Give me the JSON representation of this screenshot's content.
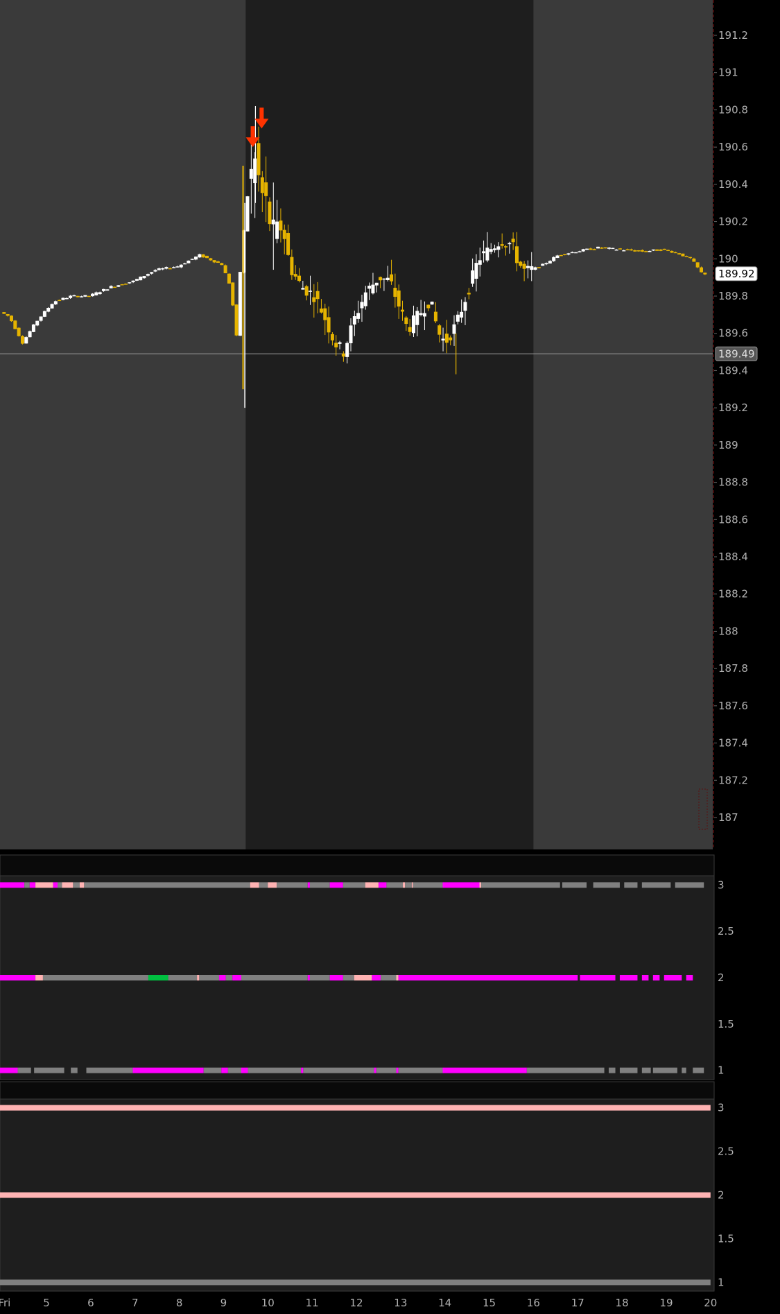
{
  "chart_data": {
    "type": "candlestick",
    "price_panel": {
      "y_ticks": [
        "191.2",
        "191",
        "190.8",
        "190.6",
        "190.4",
        "190.2",
        "190",
        "189.8",
        "189.6",
        "189.4",
        "189.2",
        "189",
        "188.8",
        "188.6",
        "188.4",
        "188.2",
        "188",
        "187.8",
        "187.6",
        "187.4",
        "187.2",
        "187"
      ],
      "y_range": [
        186.9,
        191.3
      ],
      "last_price_label": "189.92",
      "last_price": 189.92,
      "horizontal_line_label": "189.49",
      "horizontal_line": 189.49,
      "regular_session_hours": [
        9.5,
        16.0
      ],
      "signal_arrows": [
        {
          "hour": 9.66,
          "price": 190.6,
          "direction": "down"
        },
        {
          "hour": 9.86,
          "price": 190.7,
          "direction": "down"
        }
      ],
      "colors": {
        "up": "#ffffff",
        "down": "#e6b400",
        "arrow": "#ff3300",
        "session_bg": "#1e1e1e",
        "extended_bg": "#3a3a3a",
        "hline": "#a0a0a0"
      },
      "control_points": [
        [
          3.95,
          189.72
        ],
        [
          4.2,
          189.69
        ],
        [
          4.5,
          189.55
        ],
        [
          4.8,
          189.66
        ],
        [
          5.2,
          189.77
        ],
        [
          5.6,
          189.8
        ],
        [
          6,
          189.8
        ],
        [
          6.5,
          189.85
        ],
        [
          7,
          189.88
        ],
        [
          7.5,
          189.94
        ],
        [
          8,
          189.96
        ],
        [
          8.5,
          190.02
        ],
        [
          9,
          189.97
        ],
        [
          9.2,
          189.85
        ],
        [
          9.35,
          189.55
        ],
        [
          9.42,
          189.95
        ],
        [
          9.5,
          190.15
        ],
        [
          9.62,
          190.42
        ],
        [
          9.75,
          190.52
        ],
        [
          9.9,
          190.35
        ],
        [
          10.05,
          190.25
        ],
        [
          10.2,
          190.08
        ],
        [
          10.35,
          190.2
        ],
        [
          10.55,
          189.95
        ],
        [
          10.8,
          189.85
        ],
        [
          11.1,
          189.8
        ],
        [
          11.3,
          189.7
        ],
        [
          11.55,
          189.55
        ],
        [
          11.75,
          189.5
        ],
        [
          12,
          189.68
        ],
        [
          12.25,
          189.82
        ],
        [
          12.55,
          189.9
        ],
        [
          12.8,
          189.88
        ],
        [
          13,
          189.75
        ],
        [
          13.2,
          189.62
        ],
        [
          13.45,
          189.7
        ],
        [
          13.7,
          189.78
        ],
        [
          13.9,
          189.6
        ],
        [
          14.05,
          189.55
        ],
        [
          14.3,
          189.65
        ],
        [
          14.55,
          189.82
        ],
        [
          14.8,
          190.0
        ],
        [
          15.05,
          190.05
        ],
        [
          15.3,
          190.1
        ],
        [
          15.55,
          190.08
        ],
        [
          15.7,
          189.98
        ],
        [
          15.85,
          189.93
        ],
        [
          16.2,
          189.96
        ],
        [
          16.6,
          190.02
        ],
        [
          17,
          190.04
        ],
        [
          17.5,
          190.06
        ],
        [
          18,
          190.05
        ],
        [
          18.5,
          190.04
        ],
        [
          19,
          190.05
        ],
        [
          19.3,
          190.03
        ],
        [
          19.6,
          190.0
        ],
        [
          19.85,
          189.92
        ]
      ]
    },
    "indicator_panel_1": {
      "y_ticks": [
        "3",
        "2.5",
        "2",
        "1.5",
        "1"
      ],
      "y_range": [
        0.9,
        3.1
      ],
      "rows": [
        {
          "level": 3,
          "segments": [
            [
              3.95,
              4.5,
              "#ff00ff"
            ],
            [
              4.5,
              4.62,
              "#808080"
            ],
            [
              4.62,
              4.75,
              "#ff00ff"
            ],
            [
              4.75,
              5.15,
              "#ffb3b3"
            ],
            [
              5.15,
              5.25,
              "#ff00ff"
            ],
            [
              5.25,
              5.35,
              "#808080"
            ],
            [
              5.35,
              5.6,
              "#ffb3b3"
            ],
            [
              5.6,
              5.75,
              "#808080"
            ],
            [
              5.75,
              5.85,
              "#ffb3b3"
            ],
            [
              5.85,
              9.6,
              "#808080"
            ],
            [
              9.6,
              9.8,
              "#ffb3b3"
            ],
            [
              9.8,
              10.0,
              "#808080"
            ],
            [
              10.0,
              10.2,
              "#ffb3b3"
            ],
            [
              10.2,
              10.9,
              "#808080"
            ],
            [
              10.9,
              10.95,
              "#ff00ff"
            ],
            [
              10.95,
              11.4,
              "#808080"
            ],
            [
              11.4,
              11.7,
              "#ff00ff"
            ],
            [
              11.7,
              12.2,
              "#808080"
            ],
            [
              12.2,
              12.5,
              "#ffb3b3"
            ],
            [
              12.5,
              12.68,
              "#ff00ff"
            ],
            [
              12.68,
              13.05,
              "#808080"
            ],
            [
              13.05,
              13.1,
              "#ffb3b3"
            ],
            [
              13.1,
              13.25,
              "#808080"
            ],
            [
              13.25,
              13.28,
              "#ffb3b3"
            ],
            [
              13.28,
              13.95,
              "#808080"
            ],
            [
              13.95,
              14.78,
              "#ff00ff"
            ],
            [
              14.78,
              14.82,
              "#ffb3b3"
            ],
            [
              14.82,
              16.6,
              "#808080"
            ],
            [
              16.65,
              17.2,
              "#808080"
            ],
            [
              17.35,
              17.95,
              "#808080"
            ],
            [
              18.05,
              18.35,
              "#808080"
            ],
            [
              18.45,
              19.1,
              "#808080"
            ],
            [
              19.2,
              19.85,
              "#808080"
            ]
          ]
        },
        {
          "level": 2,
          "segments": [
            [
              3.95,
              4.75,
              "#ff00ff"
            ],
            [
              4.75,
              4.92,
              "#ffb3b3"
            ],
            [
              4.92,
              7.3,
              "#808080"
            ],
            [
              7.3,
              7.75,
              "#00c040"
            ],
            [
              7.75,
              8.4,
              "#808080"
            ],
            [
              8.4,
              8.45,
              "#ffb3b3"
            ],
            [
              8.45,
              8.9,
              "#808080"
            ],
            [
              8.9,
              9.05,
              "#ff00ff"
            ],
            [
              9.05,
              9.2,
              "#808080"
            ],
            [
              9.2,
              9.4,
              "#ff00ff"
            ],
            [
              9.4,
              10.9,
              "#808080"
            ],
            [
              10.9,
              10.95,
              "#ff00ff"
            ],
            [
              10.95,
              11.4,
              "#808080"
            ],
            [
              11.4,
              11.7,
              "#ff00ff"
            ],
            [
              11.7,
              11.95,
              "#808080"
            ],
            [
              11.95,
              12.35,
              "#ffb3b3"
            ],
            [
              12.35,
              12.55,
              "#ff00ff"
            ],
            [
              12.55,
              12.9,
              "#808080"
            ],
            [
              12.9,
              12.95,
              "#ffb3b3"
            ],
            [
              12.95,
              17.0,
              "#ff00ff"
            ],
            [
              17.05,
              17.85,
              "#ff00ff"
            ],
            [
              17.95,
              18.35,
              "#ff00ff"
            ],
            [
              18.45,
              18.6,
              "#ff00ff"
            ],
            [
              18.7,
              18.85,
              "#ff00ff"
            ],
            [
              18.95,
              19.35,
              "#ff00ff"
            ],
            [
              19.45,
              19.6,
              "#ff00ff"
            ]
          ]
        },
        {
          "level": 1,
          "segments": [
            [
              3.95,
              4.35,
              "#ff00ff"
            ],
            [
              4.35,
              4.65,
              "#808080"
            ],
            [
              4.72,
              5.4,
              "#808080"
            ],
            [
              5.55,
              5.7,
              "#808080"
            ],
            [
              5.9,
              6.95,
              "#808080"
            ],
            [
              6.95,
              8.55,
              "#ff00ff"
            ],
            [
              8.55,
              8.95,
              "#808080"
            ],
            [
              8.95,
              9.1,
              "#ff00ff"
            ],
            [
              9.1,
              9.4,
              "#808080"
            ],
            [
              9.4,
              9.55,
              "#ff00ff"
            ],
            [
              9.55,
              10.75,
              "#808080"
            ],
            [
              10.75,
              10.8,
              "#ff00ff"
            ],
            [
              10.8,
              12.4,
              "#808080"
            ],
            [
              12.4,
              12.45,
              "#ff00ff"
            ],
            [
              12.45,
              12.9,
              "#808080"
            ],
            [
              12.9,
              12.95,
              "#ff00ff"
            ],
            [
              12.95,
              13.95,
              "#808080"
            ],
            [
              13.95,
              15.85,
              "#ff00ff"
            ],
            [
              15.85,
              17.6,
              "#808080"
            ],
            [
              17.7,
              17.85,
              "#808080"
            ],
            [
              17.95,
              18.35,
              "#808080"
            ],
            [
              18.45,
              18.65,
              "#808080"
            ],
            [
              18.7,
              19.25,
              "#808080"
            ],
            [
              19.35,
              19.45,
              "#808080"
            ],
            [
              19.6,
              19.85,
              "#808080"
            ]
          ]
        }
      ]
    },
    "indicator_panel_2": {
      "y_ticks": [
        "3",
        "2.5",
        "2",
        "1.5",
        "1"
      ],
      "y_range": [
        0.9,
        3.1
      ],
      "rows": [
        {
          "level": 3,
          "segments": [
            [
              3.95,
              20.0,
              "#ffb3b3"
            ]
          ]
        },
        {
          "level": 2,
          "segments": [
            [
              3.95,
              20.0,
              "#ffb3b3"
            ]
          ]
        },
        {
          "level": 1,
          "segments": [
            [
              3.95,
              20.0,
              "#808080"
            ]
          ]
        }
      ]
    },
    "x_axis": {
      "tick_labels": [
        {
          "label": "Fri",
          "hour": 4.05
        },
        {
          "label": "5",
          "hour": 5
        },
        {
          "label": "6",
          "hour": 6
        },
        {
          "label": "7",
          "hour": 7
        },
        {
          "label": "8",
          "hour": 8
        },
        {
          "label": "9",
          "hour": 9
        },
        {
          "label": "10",
          "hour": 10
        },
        {
          "label": "11",
          "hour": 11
        },
        {
          "label": "12",
          "hour": 12
        },
        {
          "label": "13",
          "hour": 13
        },
        {
          "label": "14",
          "hour": 14
        },
        {
          "label": "15",
          "hour": 15
        },
        {
          "label": "16",
          "hour": 16
        },
        {
          "label": "17",
          "hour": 17
        },
        {
          "label": "18",
          "hour": 18
        },
        {
          "label": "19",
          "hour": 19
        },
        {
          "label": "20",
          "hour": 20
        }
      ],
      "range": [
        3.95,
        20.05
      ]
    }
  }
}
